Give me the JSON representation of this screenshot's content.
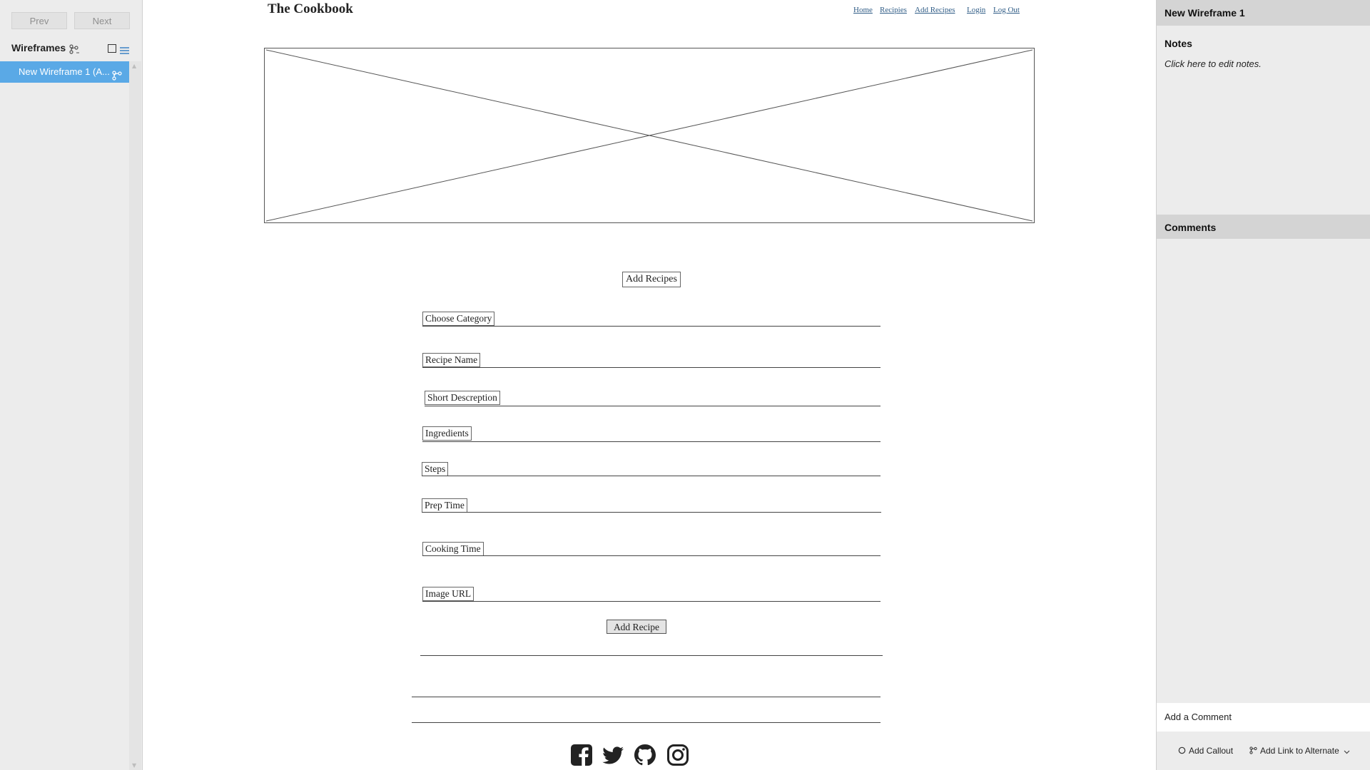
{
  "left_panel": {
    "prev_label": "Prev",
    "next_label": "Next",
    "heading": "Wireframes",
    "items": [
      {
        "label": "New Wireframe 1 (A..."
      }
    ]
  },
  "canvas": {
    "site_title": "The Cookbook",
    "nav_links": [
      "Home",
      "Recipies",
      "Add Recipes",
      "Login",
      "Log Out"
    ],
    "page_heading_button": "Add Recipes",
    "fields": [
      "Choose Category",
      "Recipe Name",
      "Short Descreption",
      "Ingredients",
      "Steps",
      "Prep Time",
      "Cooking Time",
      "Image URL"
    ],
    "submit_label": "Add Recipe",
    "social_icons": [
      "facebook-icon",
      "twitter-icon",
      "github-icon",
      "instagram-icon"
    ]
  },
  "right_panel": {
    "title": "New Wireframe 1",
    "notes_heading": "Notes",
    "notes_placeholder": "Click here to edit notes.",
    "comments_heading": "Comments",
    "add_comment_label": "Add a Comment",
    "add_callout_label": "Add Callout",
    "add_link_label": "Add Link to Alternate"
  },
  "colors": {
    "selection_blue": "#5aa9e6",
    "panel_gray": "#ececec",
    "link_blue": "#2f5c86"
  }
}
